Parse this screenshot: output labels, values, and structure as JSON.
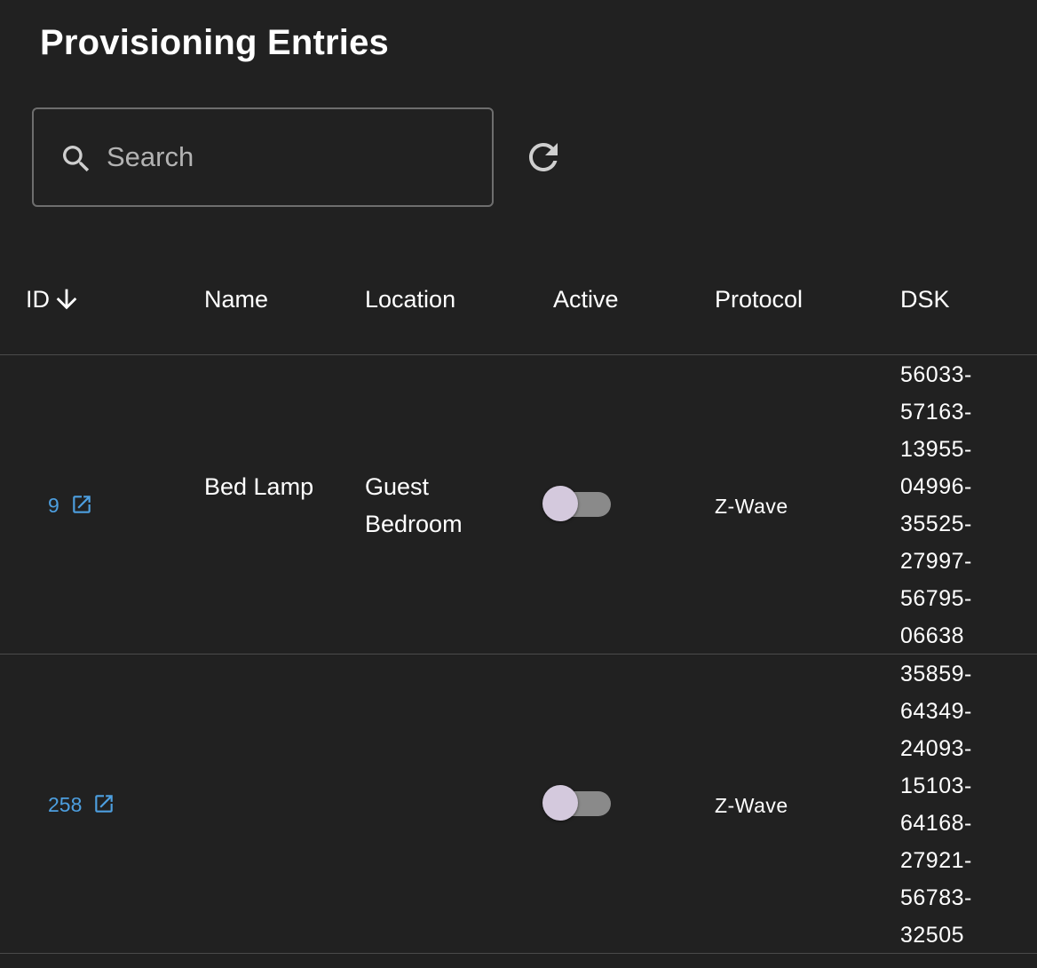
{
  "page": {
    "title": "Provisioning Entries"
  },
  "search": {
    "placeholder": "Search",
    "value": ""
  },
  "toolbar": {
    "refresh_icon": "refresh-icon"
  },
  "table": {
    "columns": {
      "id": "ID",
      "name": "Name",
      "location": "Location",
      "active": "Active",
      "protocol": "Protocol",
      "dsk": "DSK"
    },
    "sort": {
      "column": "ID",
      "direction": "descending",
      "icon": "arrow-down-icon"
    },
    "rows": [
      {
        "id": "9",
        "name": "Bed Lamp",
        "location": "Guest Bedroom",
        "active": false,
        "protocol": "Z-Wave",
        "dsk": [
          "56033-",
          "57163-",
          "13955-",
          "04996-",
          "35525-",
          "27997-",
          "56795-",
          "06638"
        ]
      },
      {
        "id": "258",
        "name": "",
        "location": "",
        "active": false,
        "protocol": "Z-Wave",
        "dsk": [
          "35859-",
          "64349-",
          "24093-",
          "15103-",
          "64168-",
          "27921-",
          "56783-",
          "32505"
        ]
      }
    ]
  },
  "colors": {
    "background": "#212121",
    "link": "#4d9fe0",
    "divider": "#4b4b4b",
    "toggle_track": "#8a8a8a",
    "toggle_thumb": "#d4c9dd"
  }
}
